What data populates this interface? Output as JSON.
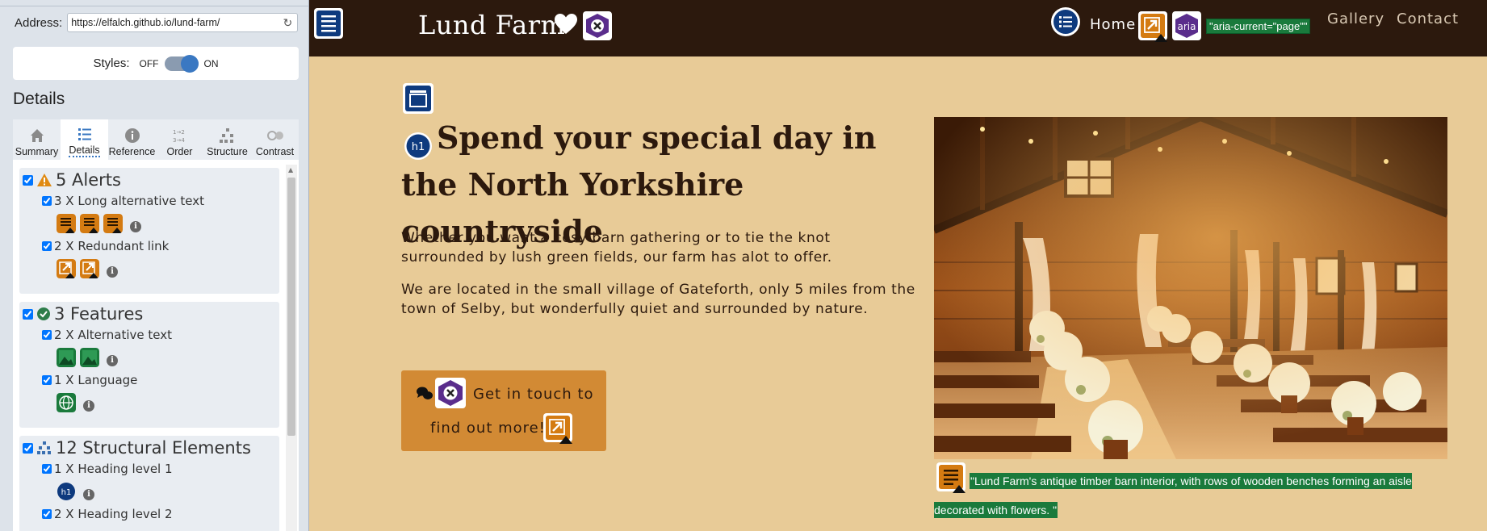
{
  "sidebar": {
    "address_label": "Address:",
    "address_value": "https://elfalch.github.io/lund-farm/",
    "styles_label": "Styles:",
    "styles_off": "OFF",
    "styles_on": "ON",
    "details_heading": "Details",
    "tabs": [
      {
        "label": "Summary",
        "icon": "home-icon"
      },
      {
        "label": "Details",
        "icon": "list-icon"
      },
      {
        "label": "Reference",
        "icon": "info-icon"
      },
      {
        "label": "Order",
        "icon": "order-icon"
      },
      {
        "label": "Structure",
        "icon": "structure-icon"
      },
      {
        "label": "Contrast",
        "icon": "contrast-icon"
      }
    ],
    "active_tab": "Details",
    "groups": [
      {
        "title": "5 Alerts",
        "items": [
          {
            "label": "3 X Long alternative text",
            "count": 3
          },
          {
            "label": "2 X Redundant link",
            "count": 2
          }
        ]
      },
      {
        "title": "3 Features",
        "items": [
          {
            "label": "2 X Alternative text",
            "count": 2
          },
          {
            "label": "1 X Language",
            "count": 1
          }
        ]
      },
      {
        "title": "12 Structural Elements",
        "items": [
          {
            "label": "1 X Heading level 1",
            "count": 1
          },
          {
            "label": "2 X Heading level 2",
            "count": 2
          }
        ]
      }
    ]
  },
  "header": {
    "site_title": "Lund Farm",
    "nav": {
      "home": "Home",
      "gallery": "Gallery",
      "contact": "Contact"
    },
    "aria_tag": "\"aria-current=\"page\"\"",
    "aria_icon_label": "aria"
  },
  "main": {
    "h1_badge": "h1",
    "heading": "Spend your special day in the North Yorkshire countryside",
    "para1": "Whether you want a cosy barn gathering or to tie the knot surrounded by lush green fields, our farm has alot to offer.",
    "para2": "We are located in the small village of Gateforth, only 5 miles from the town of Selby, but wonderfully quiet and surrounded by nature.",
    "cta_line1": "Get in touch to",
    "cta_line2": "find out more!",
    "caption": "\"Lund Farm's antique timber barn interior, with rows of wooden benches forming an aisle decorated with flowers. \""
  },
  "colors": {
    "header_bg": "#2c190d",
    "page_bg": "#e8cb97",
    "cta_bg": "#d28a34",
    "wave_green": "#1a7a3c",
    "wave_blue": "#0e3a7e",
    "wave_purple": "#5a2d8c",
    "wave_orange": "#d47b12"
  }
}
